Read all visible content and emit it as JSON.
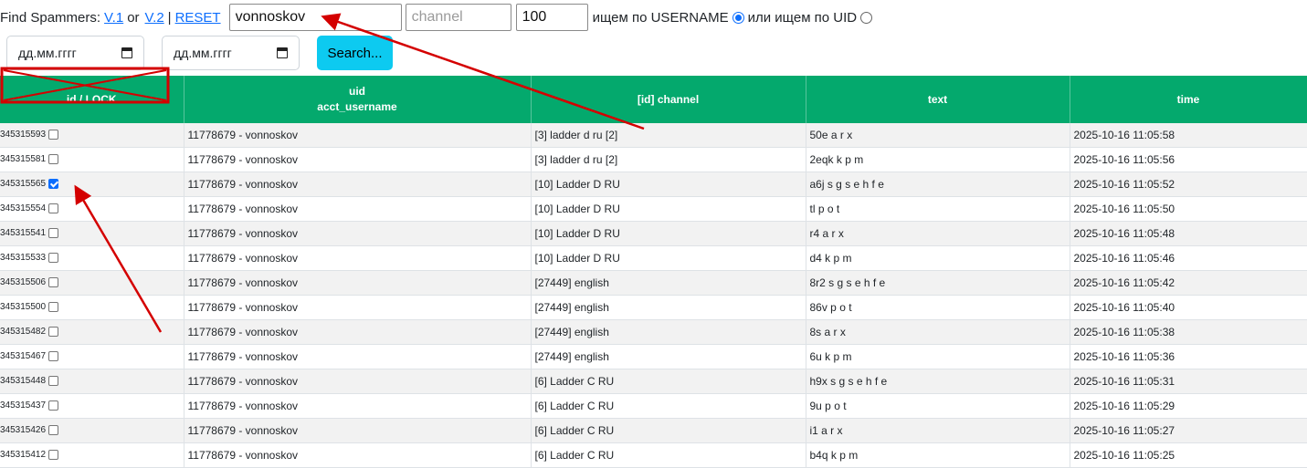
{
  "filters": {
    "label": "Find Spammers:",
    "link_v1": "V.1",
    "or_text": "or",
    "link_v2": "V.2",
    "separator": "|",
    "link_reset": "RESET",
    "username_value": "vonnoskov",
    "channel_placeholder": "channel",
    "limit_value": "100",
    "radio_username_label": "ищем по USERNAME",
    "radio_uid_label": "или ищем по UID",
    "selected_mode": "username"
  },
  "dates": {
    "from_placeholder": "дд.мм.гггг",
    "to_placeholder": "дд.мм.гггг",
    "search_label": "Search..."
  },
  "table": {
    "headers": {
      "id": "id / LOCK",
      "uid_line1": "uid",
      "uid_line2": "acct_username",
      "channel": "[id] channel",
      "text": "text",
      "time": "time"
    },
    "rows": [
      {
        "id": "345315593",
        "checked": false,
        "user": "11778679 - vonnoskov",
        "channel": "[3] ladder d ru [2]",
        "text": "50e a r x",
        "time": "2025-10-16 11:05:58"
      },
      {
        "id": "345315581",
        "checked": false,
        "user": "11778679 - vonnoskov",
        "channel": "[3] ladder d ru [2]",
        "text": "2eqk k p m",
        "time": "2025-10-16 11:05:56"
      },
      {
        "id": "345315565",
        "checked": true,
        "user": "11778679 - vonnoskov",
        "channel": "[10] Ladder D RU",
        "text": "a6j s g s e h f e",
        "time": "2025-10-16 11:05:52"
      },
      {
        "id": "345315554",
        "checked": false,
        "user": "11778679 - vonnoskov",
        "channel": "[10] Ladder D RU",
        "text": "tl p o t",
        "time": "2025-10-16 11:05:50"
      },
      {
        "id": "345315541",
        "checked": false,
        "user": "11778679 - vonnoskov",
        "channel": "[10] Ladder D RU",
        "text": "r4 a r x",
        "time": "2025-10-16 11:05:48"
      },
      {
        "id": "345315533",
        "checked": false,
        "user": "11778679 - vonnoskov",
        "channel": "[10] Ladder D RU",
        "text": "d4 k p m",
        "time": "2025-10-16 11:05:46"
      },
      {
        "id": "345315506",
        "checked": false,
        "user": "11778679 - vonnoskov",
        "channel": "[27449] english",
        "text": "8r2 s g s e h f e",
        "time": "2025-10-16 11:05:42"
      },
      {
        "id": "345315500",
        "checked": false,
        "user": "11778679 - vonnoskov",
        "channel": "[27449] english",
        "text": "86v p o t",
        "time": "2025-10-16 11:05:40"
      },
      {
        "id": "345315482",
        "checked": false,
        "user": "11778679 - vonnoskov",
        "channel": "[27449] english",
        "text": "8s a r x",
        "time": "2025-10-16 11:05:38"
      },
      {
        "id": "345315467",
        "checked": false,
        "user": "11778679 - vonnoskov",
        "channel": "[27449] english",
        "text": "6u k p m",
        "time": "2025-10-16 11:05:36"
      },
      {
        "id": "345315448",
        "checked": false,
        "user": "11778679 - vonnoskov",
        "channel": "[6] Ladder C RU",
        "text": "h9x s g s e h f e",
        "time": "2025-10-16 11:05:31"
      },
      {
        "id": "345315437",
        "checked": false,
        "user": "11778679 - vonnoskov",
        "channel": "[6] Ladder C RU",
        "text": "9u p o t",
        "time": "2025-10-16 11:05:29"
      },
      {
        "id": "345315426",
        "checked": false,
        "user": "11778679 - vonnoskov",
        "channel": "[6] Ladder C RU",
        "text": "i1 a r x",
        "time": "2025-10-16 11:05:27"
      },
      {
        "id": "345315412",
        "checked": false,
        "user": "11778679 - vonnoskov",
        "channel": "[6] Ladder C RU",
        "text": "b4q k p m",
        "time": "2025-10-16 11:05:25"
      }
    ]
  },
  "colors": {
    "header_bg": "#04a96d",
    "search_button": "#0dcaf0",
    "annotation": "#d40000"
  }
}
